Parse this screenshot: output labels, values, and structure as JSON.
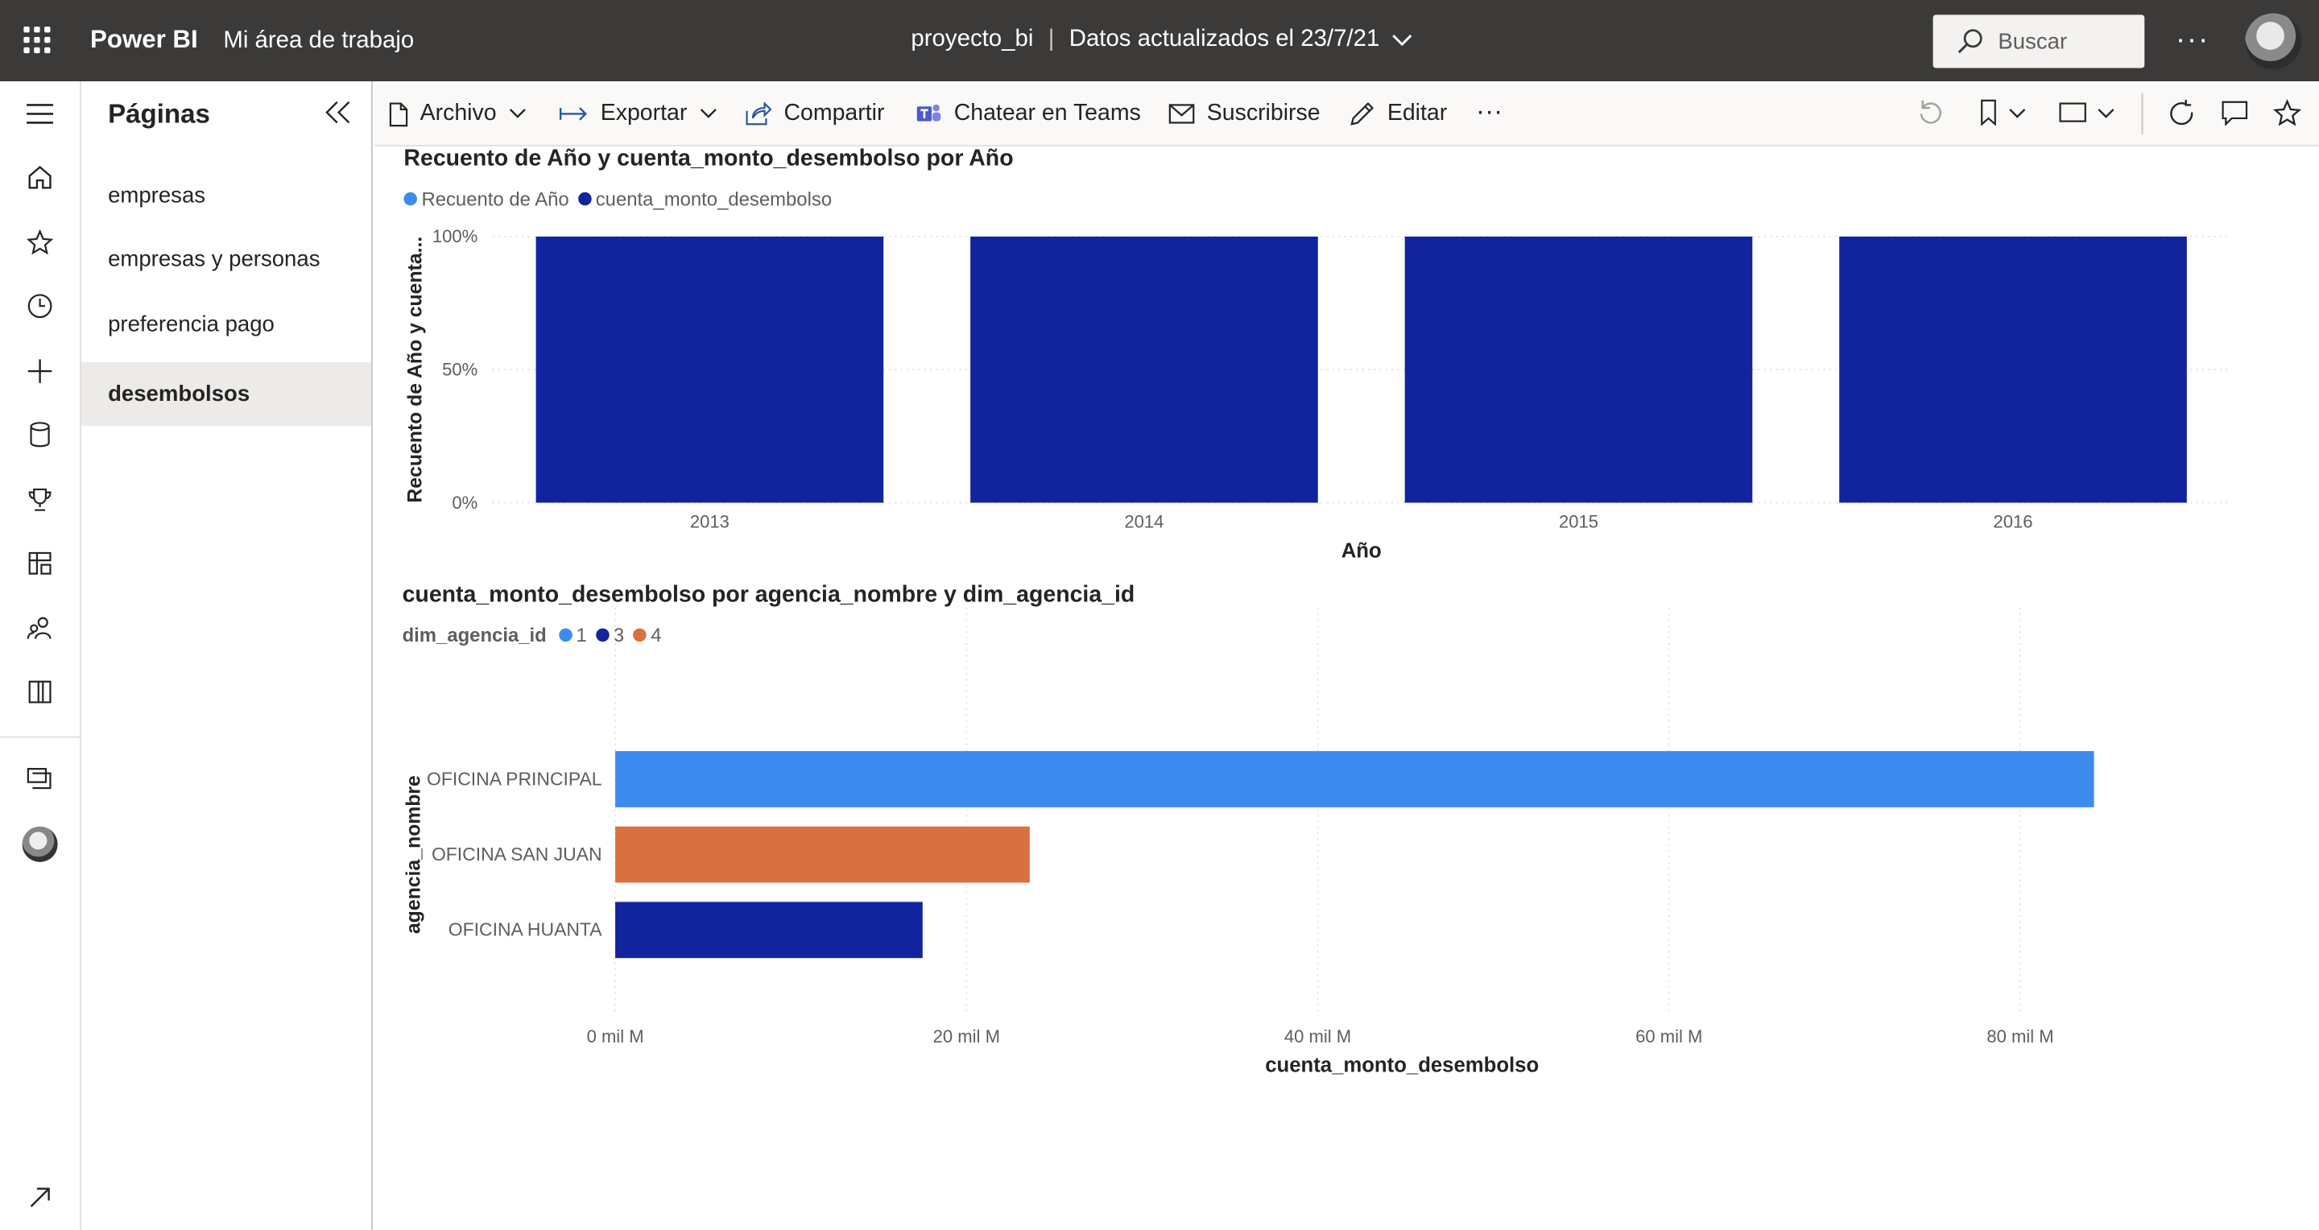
{
  "topbar": {
    "brand": "Power BI",
    "workspace": "Mi área de trabajo",
    "report_name": "proyecto_bi",
    "updated": "Datos actualizados el 23/7/21",
    "search_placeholder": "Buscar"
  },
  "pages_pane": {
    "title": "Páginas",
    "items": [
      {
        "label": "empresas"
      },
      {
        "label": "empresas y personas"
      },
      {
        "label": "preferencia pago"
      },
      {
        "label": "desembolsos",
        "active": true
      }
    ]
  },
  "toolbar": {
    "archivo": "Archivo",
    "exportar": "Exportar",
    "compartir": "Compartir",
    "teams": "Chatear en Teams",
    "suscribirse": "Suscribirse",
    "editar": "Editar"
  },
  "colors": {
    "topbar": "#3b3a39",
    "light_blue": "#3d8bef",
    "dark_blue": "#12239e",
    "orange": "#d9703f"
  },
  "chart1": {
    "title": "Recuento de Año y cuenta_monto_desembolso por Año",
    "legend": [
      "Recuento de Año",
      "cuenta_monto_desembolso"
    ]
  },
  "chart2": {
    "title": "cuenta_monto_desembolso por agencia_nombre y dim_agencia_id",
    "legend_title": "dim_agencia_id",
    "legend": [
      "1",
      "3",
      "4"
    ]
  },
  "chart_data": [
    {
      "type": "bar",
      "stacked": "100%",
      "title": "Recuento de Año y cuenta_monto_desembolso por Año",
      "categories": [
        "2013",
        "2014",
        "2015",
        "2016"
      ],
      "series": [
        {
          "name": "Recuento de Año",
          "values": [
            0,
            0,
            0,
            0
          ],
          "color": "#3d8bef"
        },
        {
          "name": "cuenta_monto_desembolso",
          "values": [
            100,
            100,
            100,
            100
          ],
          "color": "#12239e"
        }
      ],
      "xlabel": "Año",
      "ylabel": "Recuento de Año y cuenta...",
      "yticks": [
        "0%",
        "50%",
        "100%"
      ],
      "ylim": [
        0,
        100
      ]
    },
    {
      "type": "bar",
      "orientation": "horizontal",
      "title": "cuenta_monto_desembolso por agencia_nombre y dim_agencia_id",
      "categories": [
        "OFICINA PRINCIPAL",
        "OFICINA SAN JUAN",
        "OFICINA HUANTA"
      ],
      "values": [
        84.2,
        23.6,
        17.5
      ],
      "category_series": [
        "1",
        "4",
        "3"
      ],
      "colors": [
        "#3d8bef",
        "#d9703f",
        "#12239e"
      ],
      "xlabel": "cuenta_monto_desembolso",
      "ylabel": "agencia_nombre",
      "xticks": [
        "0 mil M",
        "20 mil M",
        "40 mil M",
        "60 mil M",
        "80 mil M"
      ],
      "xlim": [
        0,
        80
      ]
    }
  ]
}
